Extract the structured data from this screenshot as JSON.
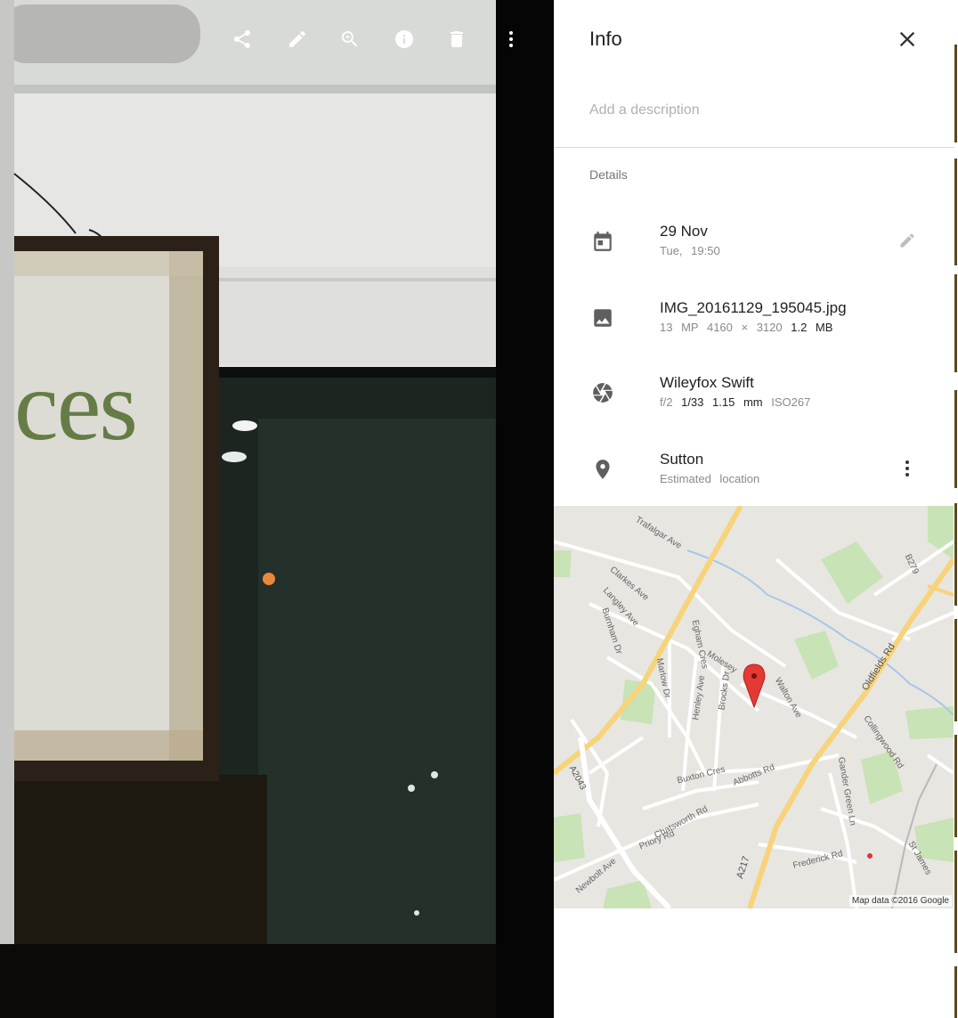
{
  "toolbar": {
    "share_icon": "share-icon",
    "edit_icon": "edit-icon",
    "zoom_icon": "zoom-in-icon",
    "info_icon": "info-icon",
    "delete_icon": "delete-icon",
    "more_icon": "more-vert-icon"
  },
  "photo": {
    "sign_text": "ces"
  },
  "panel": {
    "title": "Info",
    "description_placeholder": "Add a description",
    "details_heading": "Details",
    "date": {
      "primary": "29 Nov",
      "secondary": "Tue, 19:50"
    },
    "file": {
      "name": "IMG_20161129_195045.jpg",
      "megapixels": "13 MP",
      "resolution": "4160 × 3120",
      "size": "1.2 MB"
    },
    "camera": {
      "model": "Wileyfox Swift",
      "aperture": "f/2",
      "shutter": "1/33",
      "focal_length": "1.15 mm",
      "iso": "ISO267"
    },
    "location": {
      "primary": "Sutton",
      "secondary": "Estimated location"
    },
    "map": {
      "attribution": "Map data ©2016 Google",
      "labels": {
        "trafalgar": "Trafalgar Ave",
        "clarkes": "Clarkes Ave",
        "langley": "Langley Ave",
        "burnham": "Burnham Dr",
        "egham": "Egham Cres",
        "marlow": "Marlow Dr",
        "henley": "Henley Ave",
        "brocks": "Brocks Dr",
        "molesey": "Molesey",
        "walton": "Walton Ave",
        "oldfields": "Oldfields Rd",
        "b279": "B279",
        "collingwood": "Collingwood Rd",
        "gander": "Gander Green Ln",
        "buxton": "Buxton Cres",
        "abbotts": "Abbotts Rd",
        "a2043": "A2043",
        "priory": "Priory Rd",
        "chatsworth": "Chatsworth Rd",
        "newbolt": "Newbolt Ave",
        "a217": "A217",
        "frederick": "Frederick Rd",
        "stjames": "St James"
      }
    }
  }
}
